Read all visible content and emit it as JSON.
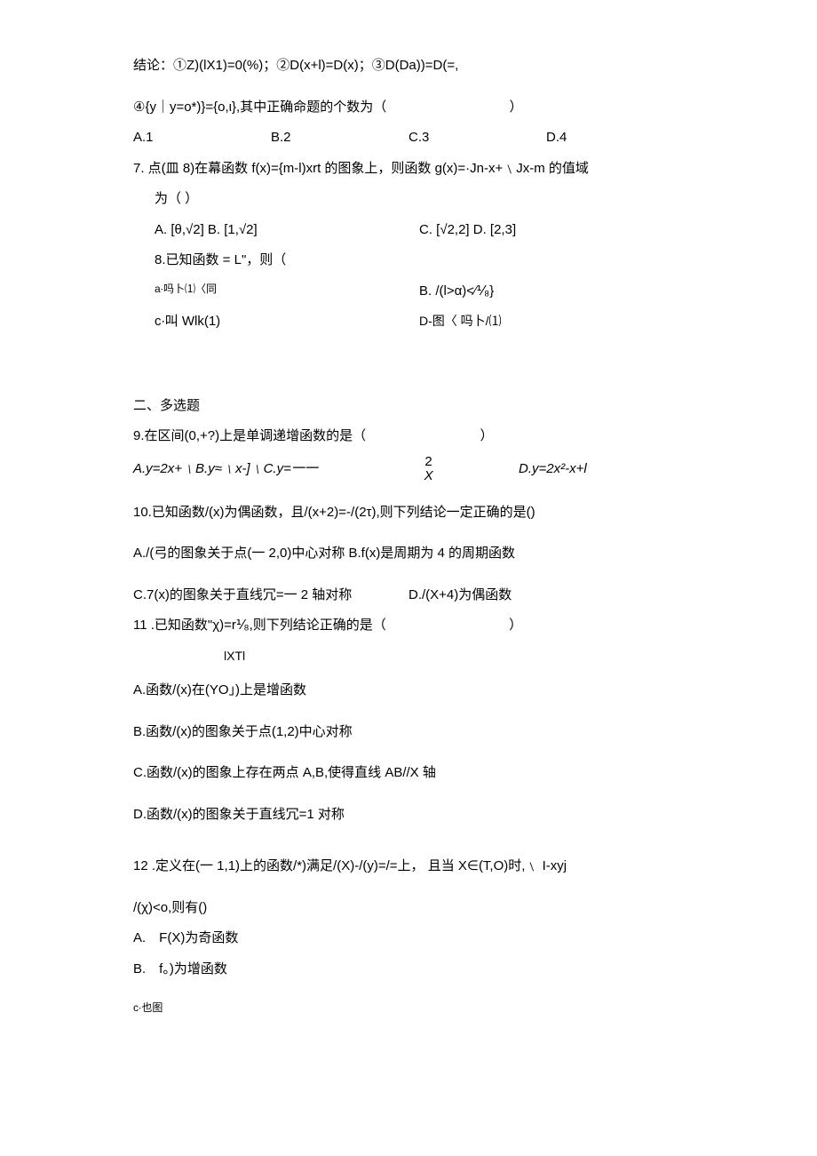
{
  "q6": {
    "intro": "结论：①Z)(lX1)=0(%)；②D(x+l)=D(x)；③D(Da))=D(=,",
    "intro2": "④{y｜y=o*)}={o,ι},其中正确命题的个数为（",
    "intro2_end": "）",
    "A": "A.1",
    "B": "B.2",
    "C": "C.3",
    "D": "D.4"
  },
  "q7": {
    "stem": "7. 点(皿 8)在幕函数 f(x)={m-l)xrt 的图象上，则函数 g(x)=·Jn-x+﹨Jx-m 的值域",
    "stem2": "为（        ）",
    "A": "A. [θ,√2] B. [1,√2]",
    "C": "C. [√2,2] D. [2,3]"
  },
  "q8": {
    "stem": "8.已知函数 = L\"，则（",
    "A": "a∙吗卜⑴〈同",
    "B": "B. /(l>α)<∕⅟₈}",
    "C": "c∙叫 Wlk(1)",
    "D": "D-图〈 吗卜/⑴"
  },
  "section2": "二、多选题",
  "q9": {
    "stem": "9.在区间(0,+?)上是单调递增函数的是（",
    "stem_end": "）",
    "A": "A.y=2x+﹨B.y≈﹨x-]﹨C.y=一一",
    "D": "D.y=2x²-x+l",
    "frac_top": "2",
    "frac_bot": "X"
  },
  "q10": {
    "stem": "10.已知函数/(x)为偶函数，且/(x+2)=-/(2τ),则下列结论一定正确的是()",
    "A": "A./(弓的图象关于点(一 2,0)中心对称 B.f(x)是周期为 4 的周期函数",
    "C": "C.7(x)的图象关于直线冗=一 2 轴对称",
    "D": "D./(X+4)为偶函数"
  },
  "q11": {
    "stem": "11 .已知函数\"χ)=r⅟₈,则下列结论正确的是（",
    "stem_end": "）",
    "sub": "lXTl",
    "A": "A.函数/(x)在(YO」)上是增函数",
    "B": "B.函数/(x)的图象关于点(1,2)中心对称",
    "C": "C.函数/(x)的图象上存在两点 A,B,使得直线 AB//X 轴",
    "D": "D.函数/(x)的图象关于直线冗=1 对称"
  },
  "q12": {
    "stem": "12 .定义在(一 1,1)上的函数/*)满足/(X)-/(y)=/=上， 且当 X∈(T,O)时,﹨ I-xyj",
    "stem2": "/(χ)<o,则有()",
    "A": "A.　F(X)为奇函数",
    "B": "B.　f。)为增函数",
    "C": "c∙也图"
  }
}
